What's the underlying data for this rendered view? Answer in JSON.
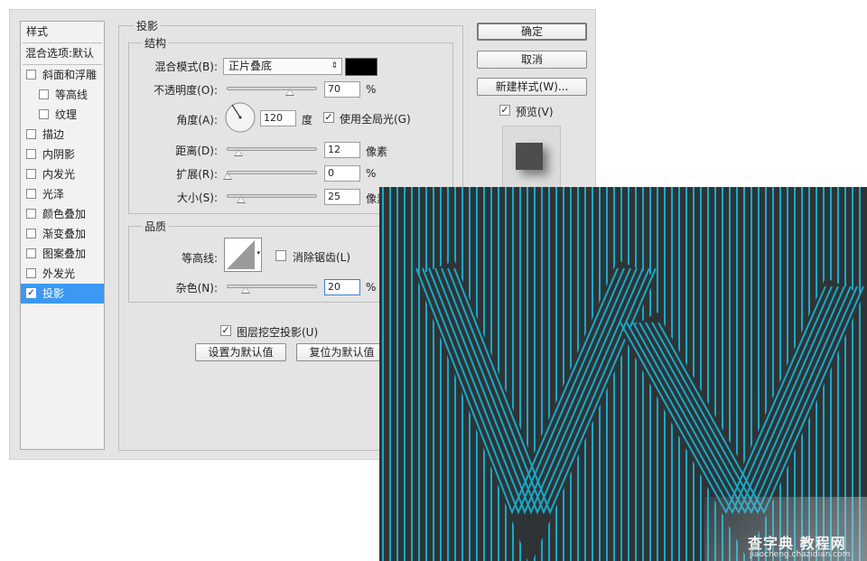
{
  "style_list": {
    "header": "样式",
    "blend_default": "混合选项:默认",
    "items": [
      {
        "label": "斜面和浮雕",
        "checked": false
      },
      {
        "label": "等高线",
        "checked": false,
        "sub": true
      },
      {
        "label": "纹理",
        "checked": false,
        "sub": true
      },
      {
        "label": "描边",
        "checked": false
      },
      {
        "label": "内阴影",
        "checked": false
      },
      {
        "label": "内发光",
        "checked": false
      },
      {
        "label": "光泽",
        "checked": false
      },
      {
        "label": "颜色叠加",
        "checked": false
      },
      {
        "label": "渐变叠加",
        "checked": false
      },
      {
        "label": "图案叠加",
        "checked": false
      },
      {
        "label": "外发光",
        "checked": false
      },
      {
        "label": "投影",
        "checked": true,
        "selected": true
      }
    ]
  },
  "panel": {
    "title": "投影",
    "structure": {
      "title": "结构",
      "blend_mode_label": "混合模式(B):",
      "blend_mode_value": "正片叠底",
      "shadow_color": "#000000",
      "opacity_label": "不透明度(O):",
      "opacity_value": "70",
      "opacity_level": 0.7,
      "opacity_unit": "%",
      "angle_label": "角度(A):",
      "angle_value": "120",
      "angle_unit": "度",
      "global_light_label": "使用全局光(G)",
      "global_light_checked": true,
      "distance_label": "距离(D):",
      "distance_value": "12",
      "distance_unit": "像素",
      "spread_label": "扩展(R):",
      "spread_value": "0",
      "spread_unit": "%",
      "size_label": "大小(S):",
      "size_value": "25",
      "size_unit": "像素"
    },
    "quality": {
      "title": "品质",
      "contour_label": "等高线:",
      "antialias_label": "消除锯齿(L)",
      "antialias_checked": false,
      "noise_label": "杂色(N):",
      "noise_value": "20",
      "noise_unit": "%"
    },
    "knockout_label": "图层挖空投影(U)",
    "knockout_checked": true,
    "make_default_label": "设置为默认值",
    "reset_default_label": "复位为默认值"
  },
  "buttons": {
    "ok": "确定",
    "cancel": "取消",
    "new_style": "新建样式(W)...",
    "preview_label": "预览(V)",
    "preview_checked": true
  },
  "watermark": {
    "main": "查字典 教程网",
    "sub": "jiaocheng.chazidian.com"
  },
  "colors": {
    "accent": "#3b98f3",
    "stripe": "#19a9c9",
    "artwork_bg": "#2e3436"
  }
}
